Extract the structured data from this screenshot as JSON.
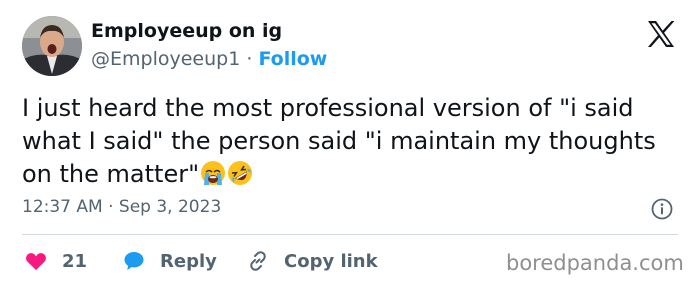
{
  "tweet": {
    "author_name": "Employeeup on ig",
    "author_handle": "@Employeeup1",
    "separator": "·",
    "follow_label": "Follow",
    "text": "I just heard the most professional version of \"i said what I said\" the person said \"i maintain my thoughts on the matter\"",
    "emojis": [
      "loudly-crying-face",
      "rolling-on-the-floor-laughing"
    ],
    "time": "12:37 AM",
    "date": "Sep 3, 2023",
    "like_count": "21",
    "reply_label": "Reply",
    "copy_link_label": "Copy link"
  },
  "watermark": "boredpanda.com",
  "colors": {
    "accent": "#1d9bf0",
    "like": "#f91880",
    "text": "#0f1419",
    "muted": "#536471"
  },
  "icons": {
    "logo": "x-logo-icon",
    "info": "info-icon",
    "like": "heart-icon",
    "reply": "speech-bubble-icon",
    "copy_link": "link-icon"
  }
}
